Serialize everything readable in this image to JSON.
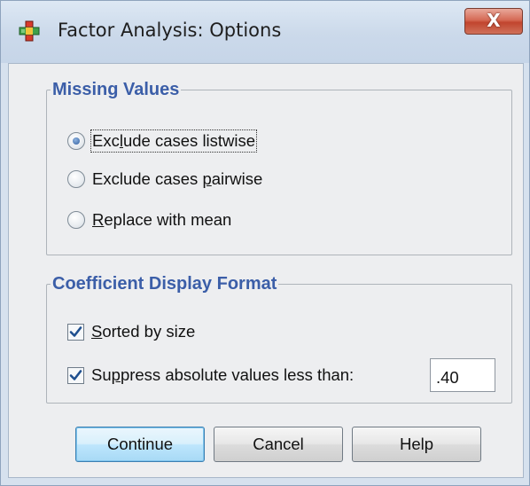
{
  "window": {
    "title": "Factor Analysis: Options",
    "close_label": "X"
  },
  "missing_values": {
    "legend": "Missing Values",
    "options": [
      {
        "label_pre": "Exc",
        "label_u": "l",
        "label_post": "ude cases listwise",
        "selected": true
      },
      {
        "label_pre": "Exclude cases ",
        "label_u": "p",
        "label_post": "airwise",
        "selected": false
      },
      {
        "label_pre": "",
        "label_u": "R",
        "label_post": "eplace with mean",
        "selected": false
      }
    ]
  },
  "coefficient_display": {
    "legend": "Coefficient Display Format",
    "sorted": {
      "label_u": "S",
      "label_post": "orted by size",
      "checked": true
    },
    "suppress": {
      "label_pre": "Su",
      "label_u": "p",
      "label_post": "press absolute values less than:",
      "checked": true
    },
    "suppress_value": ".40"
  },
  "buttons": {
    "continue": "Continue",
    "cancel": "Cancel",
    "help": "Help"
  },
  "colors": {
    "accent": "#3b5ea8",
    "close_button": "#c1452e",
    "default_button": "#bee6fd"
  }
}
